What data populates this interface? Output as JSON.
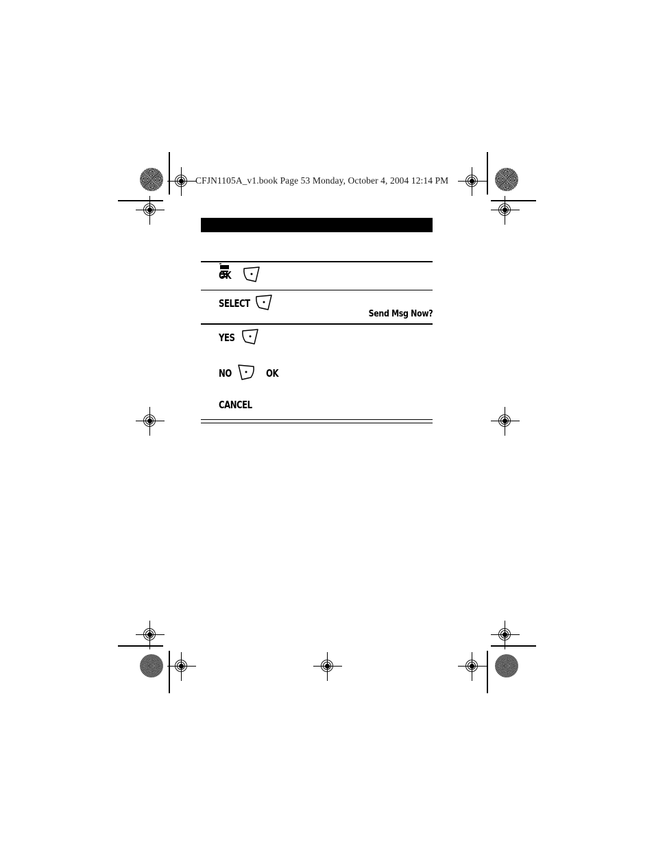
{
  "document": {
    "running_header": "CFJN1105A_v1.book  Page 53  Monday, October 4, 2004  12:14 PM",
    "page_number": "53"
  },
  "content": {
    "heading_bar": {
      "redacted": true,
      "color": "#000000"
    },
    "menu_icon_name": "menu-key-icon",
    "steps": [
      {
        "id": "step-ok",
        "label": "OK",
        "softkey": "right-soft-key-icon"
      },
      {
        "id": "step-select",
        "label": "SELECT",
        "softkey": "right-soft-key-icon"
      },
      {
        "id": "step-yes",
        "label": "YES",
        "softkey": "right-soft-key-icon"
      },
      {
        "id": "step-no",
        "label": "NO",
        "label2": "OK",
        "softkey": "left-soft-key-icon"
      },
      {
        "id": "step-cancel",
        "label": "CANCEL",
        "softkey": null
      }
    ],
    "display_prompt": "Send Msg Now?"
  },
  "print_marks": {
    "registration_name": "registration-target-mark",
    "halftone_name": "halftone-density-patch",
    "crop_line_name": "crop-mark-line"
  }
}
